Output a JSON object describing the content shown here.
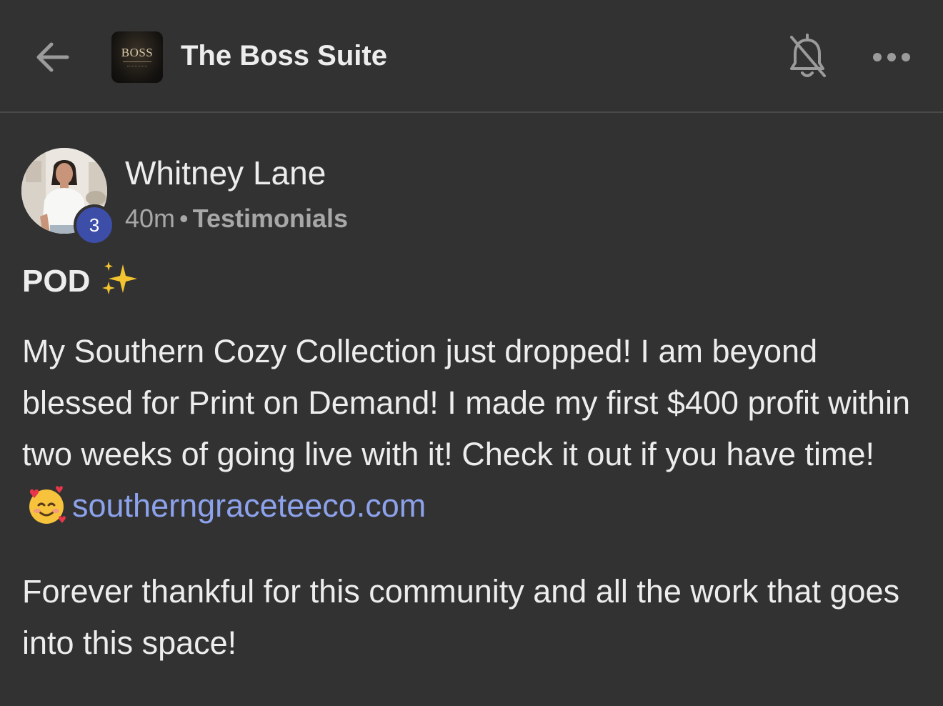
{
  "header": {
    "back_icon": "arrow-left-icon",
    "logo_text": "BOSS",
    "group_title": "The Boss Suite",
    "bell_icon": "bell-off-icon",
    "more_icon": "more-horizontal-icon"
  },
  "post": {
    "author": {
      "name": "Whitney Lane",
      "level": "3"
    },
    "time": "40m",
    "separator": "•",
    "category": "Testimonials",
    "title": "POD",
    "title_emoji": "sparkles-icon",
    "body_text_1": "My Southern Cozy Collection just dropped! I am beyond blessed for Print on Demand! I made my first $400 profit within two weeks of going live with it! Check it out if you have time!",
    "body_emoji": "smiling-face-with-hearts-icon",
    "link_text": "southerngraceteeco.com",
    "body_text_2": "Forever thankful for this community and all the work that goes into this space!"
  },
  "colors": {
    "background": "#323232",
    "text": "#ededed",
    "muted": "#a8a8a8",
    "link": "#8da2ec",
    "badge": "#3d4ea8"
  }
}
